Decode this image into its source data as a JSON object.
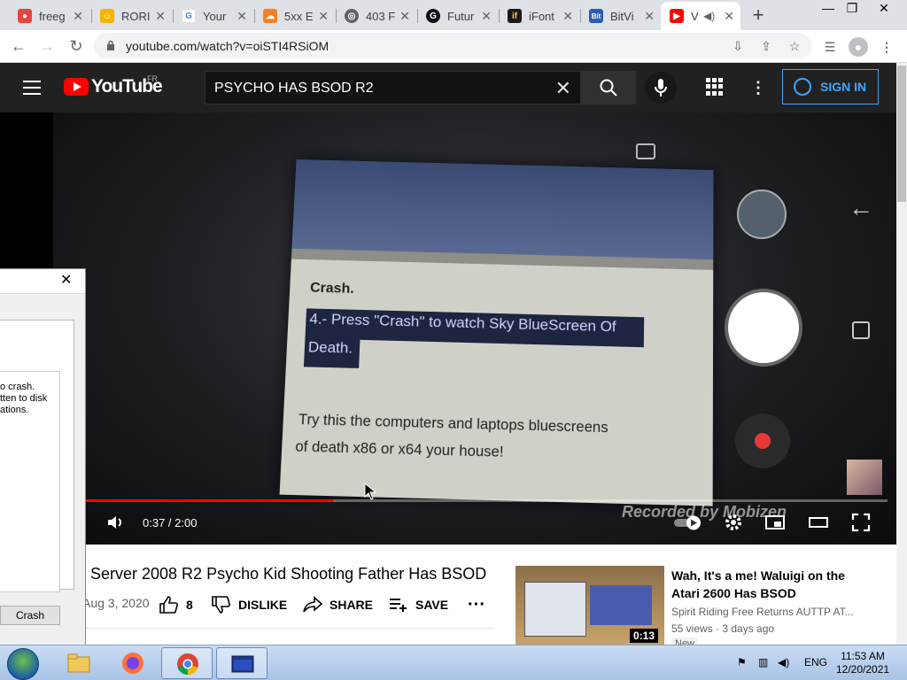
{
  "browser": {
    "tabs": [
      {
        "title": "freeg",
        "favicon": "game-icon",
        "color": "#e8453c"
      },
      {
        "title": "RORI",
        "favicon": "emoji-icon",
        "color": "#f4b400"
      },
      {
        "title": "Your",
        "favicon": "google-icon",
        "color": "#4285f4"
      },
      {
        "title": "5xx E",
        "favicon": "cloud-icon",
        "color": "#f48120"
      },
      {
        "title": "403 F",
        "favicon": "globe-icon",
        "color": "#5f6368"
      },
      {
        "title": "Futur",
        "favicon": "g-icon",
        "color": "#111111"
      },
      {
        "title": "iFont",
        "favicon": "if-icon",
        "color": "#1a1a1a"
      },
      {
        "title": "BitVi",
        "favicon": "bitview-icon",
        "color": "#2a5db0"
      },
      {
        "title": "V",
        "favicon": "youtube-icon",
        "color": "#ff0000"
      }
    ],
    "url": "youtube.com/watch?v=oiSTI4RSiOM"
  },
  "youtube": {
    "logo_text": "YouTube",
    "country": "FR",
    "search_value": "PSYCHO HAS BSOD R2",
    "sign_in": "SIGN IN"
  },
  "player": {
    "time": "0:37 / 2:00",
    "progress": 0.308,
    "watermark": "Recorded by Mobizen",
    "screen_text": {
      "crash": "Crash.",
      "step4_line1": "4.- Press \"Crash\" to watch Sky BlueScreen Of",
      "step4_line2": "Death.",
      "try_line1": "Try this the computers and laptops bluescreens",
      "try_line2": "of death x86 or x64 your house!"
    }
  },
  "video": {
    "title": "Server 2008 R2 Psycho Kid Shooting Father Has BSOD",
    "date": "Aug 3, 2020",
    "likes": "8",
    "dislike": "DISLIKE",
    "share": "SHARE",
    "save": "SAVE"
  },
  "recommendation": {
    "title": "Wah, It's a me! Waluigi on the Atari 2600 Has BSOD",
    "channel": "Spirit Riding Free Returns AUTTP AT...",
    "views": "55 views · 3 days ago",
    "badge": "New",
    "duration": "0:13"
  },
  "dialog": {
    "text": "o crash.\ntten to disk\nations.",
    "button": "Crash"
  },
  "taskbar": {
    "language": "ENG",
    "time": "11:53 AM",
    "date": "12/20/2021"
  }
}
